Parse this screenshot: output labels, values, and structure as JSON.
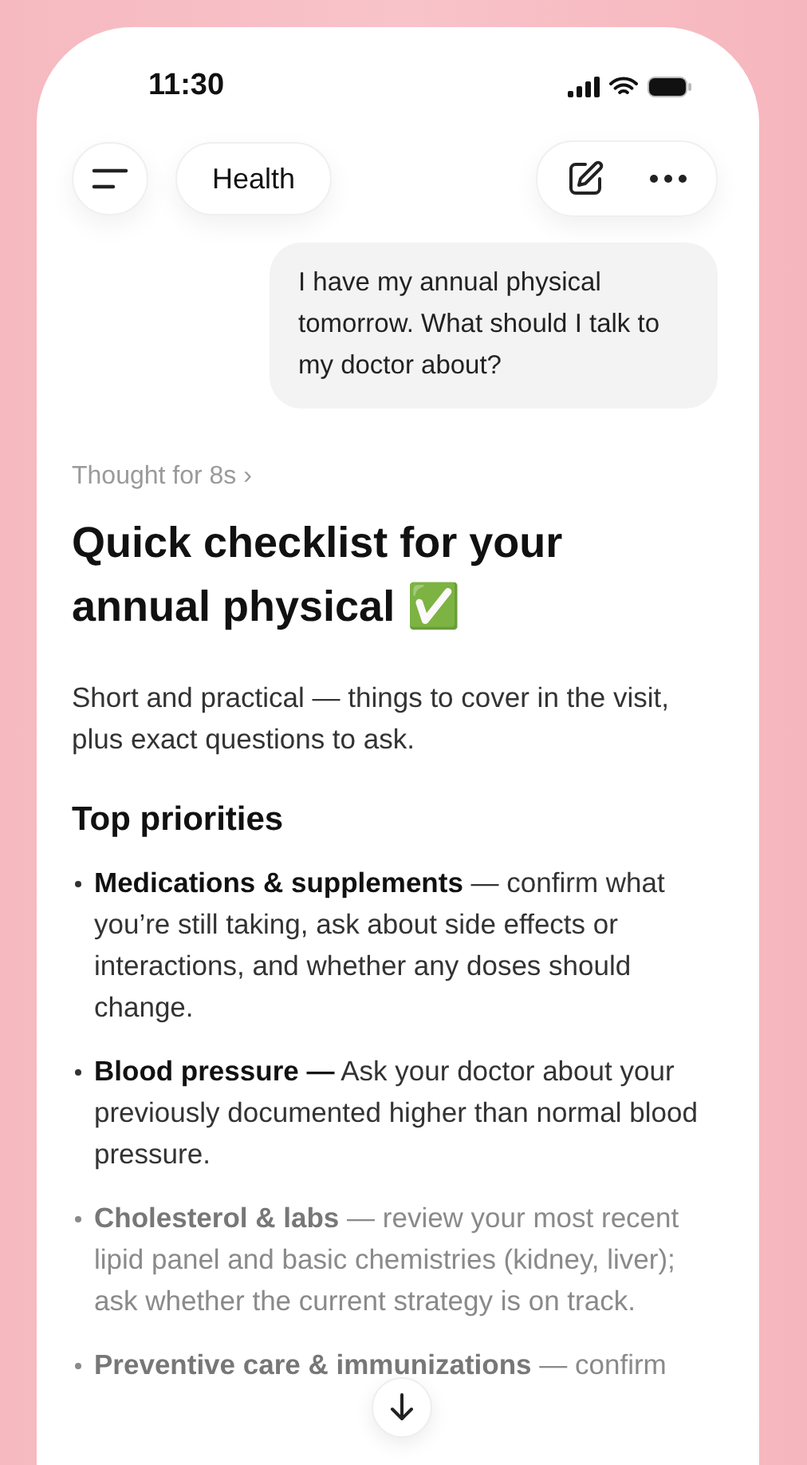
{
  "status_bar": {
    "time": "11:30"
  },
  "header": {
    "title": "Health"
  },
  "user_message": "I have my annual physical tomorrow. What should I talk to my doctor about?",
  "thought": "Thought for 8s ›",
  "heading": "Quick checklist for your annual physical ✅",
  "intro": "Short and practical — things to cover in the visit, plus exact questions to ask.",
  "section_title": "Top priorities",
  "items": [
    {
      "text": "**Medications & supplements** — confirm what you’re still taking, ask about side effects or interactions, and whether any doses should change.",
      "faded": false
    },
    {
      "text": "**Blood pressure —** Ask your doctor about your previously documented higher than normal blood pressure.",
      "faded": false
    },
    {
      "text": "**Cholesterol & labs** — review your most recent lipid panel and basic chemistries (kidney, liver); ask whether the current strategy is on track.",
      "faded": true
    },
    {
      "text": "**Preventive care & immunizations** — confirm",
      "faded": true
    }
  ]
}
